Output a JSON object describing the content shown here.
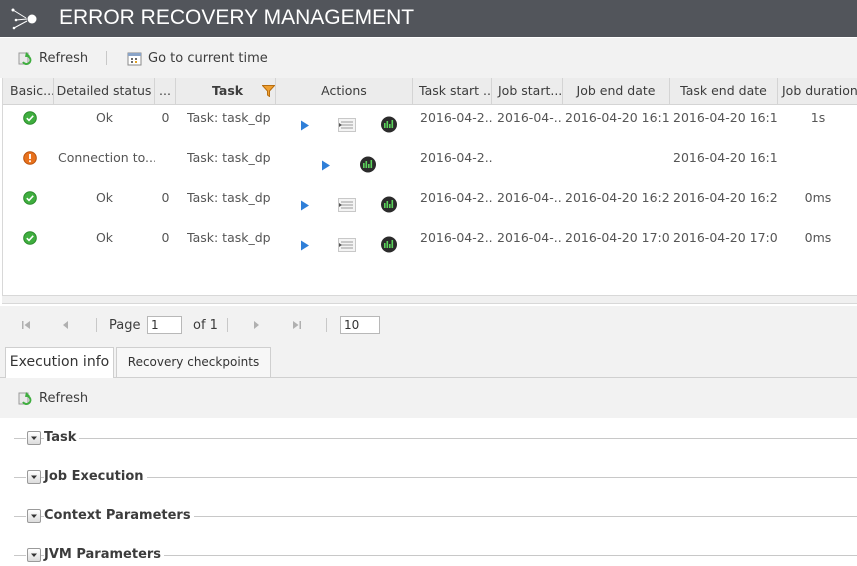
{
  "app": {
    "title": "ERROR RECOVERY MANAGEMENT"
  },
  "toolbar": {
    "refresh_label": "Refresh",
    "current_time_label": "Go to current time"
  },
  "grid": {
    "columns": [
      "Basic...",
      "Detailed status",
      "...",
      "Task",
      "Actions",
      "Task start ...",
      "Job start...",
      "Job end date",
      "Task end date",
      "Job duration"
    ],
    "rows": [
      {
        "status": "ok",
        "detailed_status": "Ok",
        "count": "0",
        "task": "Task: task_dp",
        "task_start": "2016-04-2...",
        "job_start": "2016-04-...",
        "job_end": "2016-04-20 16:1...",
        "task_end": "2016-04-20 16:1...",
        "duration": "1s"
      },
      {
        "status": "error",
        "detailed_status": "Connection to...",
        "count": "",
        "task": "Task: task_dp",
        "task_start": "2016-04-2...",
        "job_start": "",
        "job_end": "",
        "task_end": "2016-04-20 16:1...",
        "duration": ""
      },
      {
        "status": "ok",
        "detailed_status": "Ok",
        "count": "0",
        "task": "Task: task_dp",
        "task_start": "2016-04-2...",
        "job_start": "2016-04-...",
        "job_end": "2016-04-20 16:2...",
        "task_end": "2016-04-20 16:2...",
        "duration": "0ms"
      },
      {
        "status": "ok",
        "detailed_status": "Ok",
        "count": "0",
        "task": "Task: task_dp",
        "task_start": "2016-04-2...",
        "job_start": "2016-04-...",
        "job_end": "2016-04-20 17:0...",
        "task_end": "2016-04-20 17:0...",
        "duration": "0ms"
      }
    ]
  },
  "pager": {
    "page_label": "Page",
    "page_value": "1",
    "of_label": "of 1",
    "page_size": "10"
  },
  "tabs": {
    "execution_info": "Execution info",
    "recovery_checkpoints": "Recovery checkpoints"
  },
  "details": {
    "refresh_label": "Refresh",
    "sections": [
      "Task",
      "Job Execution",
      "Context Parameters",
      "JVM Parameters"
    ]
  },
  "colors": {
    "titlebar": "#52555b",
    "ok_green": "#3fae3f",
    "error_orange": "#e8711c",
    "play_blue": "#2f7fd8",
    "filter_orange": "#f0a030"
  },
  "icons": {
    "status_ok": "check-circle-icon",
    "status_error": "exclamation-circle-icon",
    "play": "play-icon",
    "log": "log-list-icon",
    "monitor": "monitor-chart-icon"
  }
}
